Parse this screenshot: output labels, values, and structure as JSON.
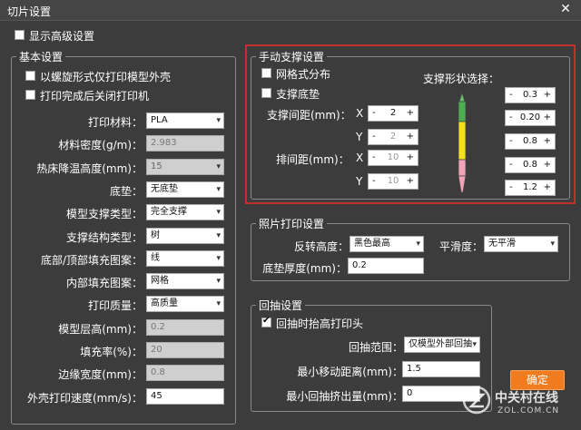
{
  "window": {
    "title": "切片设置",
    "close": "✕"
  },
  "show_advanced": {
    "label": "显示高级设置",
    "checked": false
  },
  "basic": {
    "legend": "基本设置",
    "spiral": {
      "label": "以螺旋形式仅打印模型外壳",
      "checked": false
    },
    "shutdown": {
      "label": "打印完成后关闭打印机",
      "checked": false
    },
    "rows": [
      {
        "label": "打印材料：",
        "kind": "select",
        "value": "PLA",
        "disabled": false
      },
      {
        "label": "材料密度(g/m)：",
        "kind": "text",
        "value": "2.983",
        "disabled": true
      },
      {
        "label": "热床降温高度(mm)：",
        "kind": "select",
        "value": "15",
        "disabled": true
      },
      {
        "label": "底垫：",
        "kind": "select",
        "value": "无底垫",
        "disabled": false
      },
      {
        "label": "模型支撑类型：",
        "kind": "select",
        "value": "完全支撑",
        "disabled": false
      },
      {
        "label": "支撑结构类型：",
        "kind": "select",
        "value": "树",
        "disabled": false
      },
      {
        "label": "底部/顶部填充图案：",
        "kind": "select",
        "value": "线",
        "disabled": false
      },
      {
        "label": "内部填充图案：",
        "kind": "select",
        "value": "网格",
        "disabled": false
      },
      {
        "label": "打印质量：",
        "kind": "select",
        "value": "高质量",
        "disabled": false
      },
      {
        "label": "模型层高(mm)：",
        "kind": "text",
        "value": "0.2",
        "disabled": true
      },
      {
        "label": "填充率(%)：",
        "kind": "text",
        "value": "20",
        "disabled": true
      },
      {
        "label": "边缘宽度(mm)：",
        "kind": "text",
        "value": "0.8",
        "disabled": true
      },
      {
        "label": "外壳打印速度(mm/s)：",
        "kind": "text",
        "value": "45",
        "disabled": false
      }
    ]
  },
  "manual": {
    "legend": "手动支撑设置",
    "grid": {
      "label": "网格式分布",
      "checked": false
    },
    "base": {
      "label": "支撑底垫",
      "checked": false
    },
    "shape_label": "支撑形状选择：",
    "spacing_label": "支撑间距(mm)：",
    "row_spacing_label": "排间距(mm)：",
    "x_label": "X",
    "y_label": "Y",
    "spacing_x": "2",
    "spacing_y": "2",
    "row_x": "10",
    "row_y": "10",
    "shape_values": [
      "0.3",
      "0.20",
      "0.8",
      "0.8",
      "1.2"
    ],
    "minus": "-",
    "plus": "+"
  },
  "photo": {
    "legend": "照片打印设置",
    "invert_label": "反转高度：",
    "invert_value": "黑色最高",
    "smooth_label": "平滑度：",
    "smooth_value": "无平滑",
    "base_thick_label": "底垫厚度(mm)：",
    "base_thick_value": "0.2"
  },
  "retract": {
    "legend": "回抽设置",
    "lift": {
      "label": "回抽时抬高打印头",
      "checked": true
    },
    "range_label": "回抽范围：",
    "range_value": "仅模型外部回抽",
    "min_move_label": "最小移动距离(mm)：",
    "min_move_value": "1.5",
    "min_extrude_label": "最小回抽挤出量(mm)：",
    "min_extrude_value": "0"
  },
  "ok_label": "确定",
  "watermark": {
    "main": "中关村在线",
    "sub": "ZOL.COM.CN"
  }
}
